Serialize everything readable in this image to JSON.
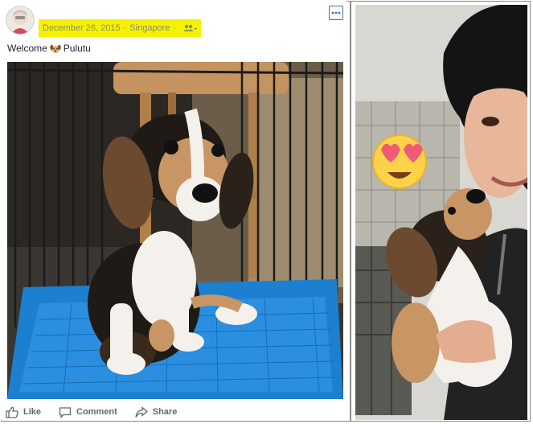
{
  "post": {
    "date": "December 26, 2015",
    "separator": "·",
    "location": "Singapore",
    "audience_icon": "friends-icon",
    "caption_prefix": "Welcome",
    "caption_emoji": "dog-face",
    "caption_name": "Pulutu",
    "more_icon": "more-options-icon"
  },
  "actions": {
    "like_label": "Like",
    "comment_label": "Comment",
    "share_label": "Share"
  },
  "colors": {
    "highlight": "#f4f200",
    "tray_blue": "#1d7fd0",
    "action_text": "#616770"
  }
}
